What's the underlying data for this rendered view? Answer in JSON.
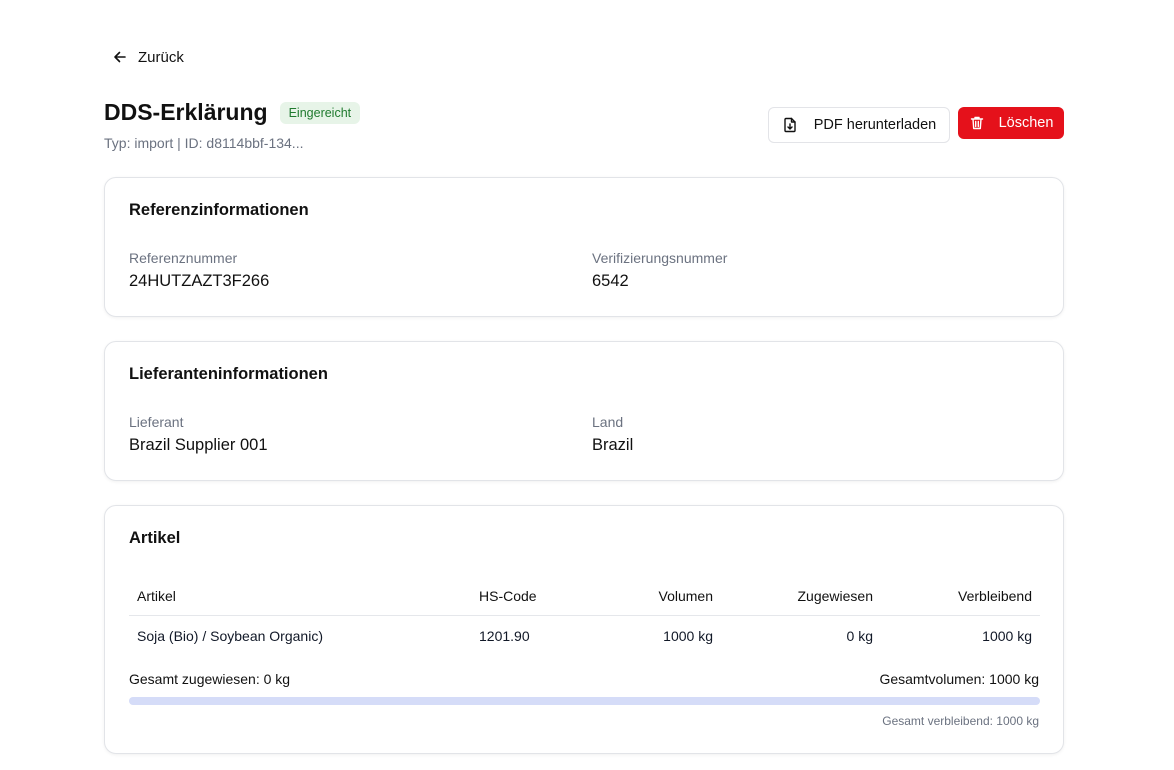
{
  "nav": {
    "back_label": "Zurück"
  },
  "header": {
    "title": "DDS-Erklärung",
    "status_badge": "Eingereicht",
    "subtitle": "Typ: import | ID: d8114bbf-134...",
    "download_label": "PDF herunterladen",
    "delete_label": "Löschen"
  },
  "colors": {
    "danger": "#e5111b",
    "badge_bg": "#e7f4e8",
    "badge_text": "#1f7a2e",
    "progress_track": "#d5dcf8"
  },
  "reference": {
    "title": "Referenzinformationen",
    "ref_label": "Referenznummer",
    "ref_value": "24HUTZAZT3F266",
    "verify_label": "Verifizierungsnummer",
    "verify_value": "6542"
  },
  "supplier": {
    "title": "Lieferanteninformationen",
    "supplier_label": "Lieferant",
    "supplier_value": "Brazil Supplier 001",
    "country_label": "Land",
    "country_value": "Brazil"
  },
  "articles": {
    "title": "Artikel",
    "columns": [
      "Artikel",
      "HS-Code",
      "Volumen",
      "Zugewiesen",
      "Verbleibend"
    ],
    "rows": [
      [
        "Soja (Bio) / Soybean Organic)",
        "1201.90",
        "1000 kg",
        "0 kg",
        "1000 kg"
      ]
    ],
    "total_assigned": "Gesamt zugewiesen: 0 kg",
    "total_volume": "Gesamtvolumen: 1000 kg",
    "progress_fraction": 0,
    "total_remaining": "Gesamt verbleibend: 1000 kg"
  }
}
